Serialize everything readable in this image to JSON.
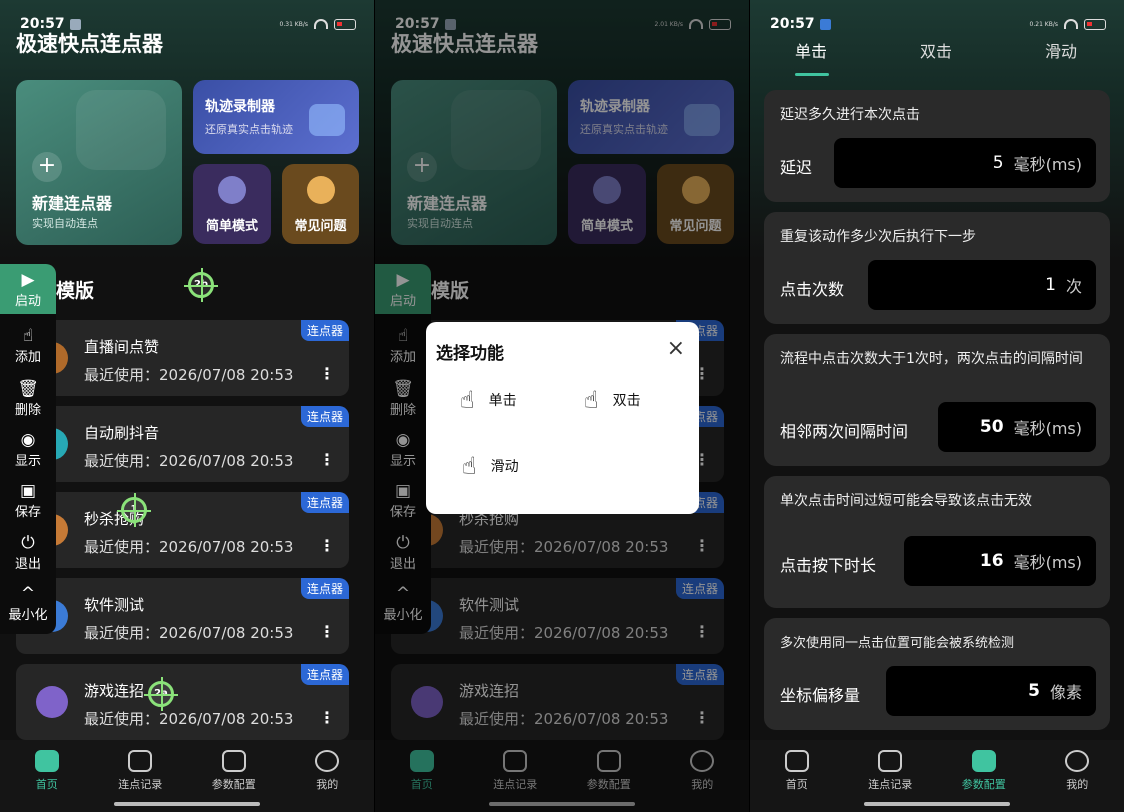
{
  "status": {
    "time1": "20:57",
    "time2": "20:57",
    "time3": "20:57",
    "speed1": "0.31 KB/s",
    "speed2": "2.01 KB/s",
    "speed3": "0.21 KB/s"
  },
  "app_title": "极速快点连点器",
  "cards": {
    "new_title": "新建连点器",
    "new_sub": "实现自动连点",
    "track_title": "轨迹录制器",
    "track_sub": "还原真实点击轨迹",
    "simple_mode": "简单模式",
    "faq": "常见问题"
  },
  "section_title": "模版",
  "items": [
    {
      "name": "直播间点赞",
      "tag": "连点器",
      "last": "最近使用：2026/07/08 20:53"
    },
    {
      "name": "自动刷抖音",
      "tag": "连点器",
      "last": "最近使用：2026/07/08 20:53"
    },
    {
      "name": "秒杀抢购",
      "tag": "连点器",
      "last": "最近使用：2026/07/08 20:53"
    },
    {
      "name": "软件测试",
      "tag": "连点器",
      "last": "最近使用：2026/07/08 20:53"
    },
    {
      "name": "游戏连招",
      "tag": "连点器",
      "last": "最近使用：2026/07/08 20:53"
    }
  ],
  "float_bar": {
    "start": "启动",
    "add": "添加",
    "delete": "删除",
    "show": "显示",
    "save": "保存",
    "exit": "退出",
    "minimize": "最小化"
  },
  "trackers": {
    "t1": "1",
    "t2a": "2a",
    "t2b": "2b"
  },
  "nav": {
    "home": "首页",
    "records": "连点记录",
    "params": "参数配置",
    "me": "我的"
  },
  "dialog": {
    "title": "选择功能",
    "single": "单击",
    "double": "双击",
    "swipe": "滑动",
    "close": "×"
  },
  "tabs": {
    "single": "单击",
    "double": "双击",
    "swipe": "滑动"
  },
  "params": [
    {
      "question": "延迟多久进行本次点击",
      "label": "延迟",
      "value": "5",
      "unit": "毫秒(ms)"
    },
    {
      "question": "重复该动作多少次后执行下一步",
      "label": "点击次数",
      "value": "1",
      "unit": "次"
    },
    {
      "question": "流程中点击次数大于1次时，两次点击的间隔时间",
      "label": "相邻两次间隔时间",
      "value": "50",
      "unit": "毫秒(ms)"
    },
    {
      "question": "单次点击时间过短可能会导致该点击无效",
      "label": "点击按下时长",
      "value": "16",
      "unit": "毫秒(ms)"
    },
    {
      "question": "多次使用同一点击位置可能会被系统检测",
      "label": "坐标偏移量",
      "value": "5",
      "unit": "像素"
    }
  ],
  "colors": {
    "accent": "#40c4a0",
    "tag": "#2c68d6",
    "tracker": "#8be27a"
  }
}
